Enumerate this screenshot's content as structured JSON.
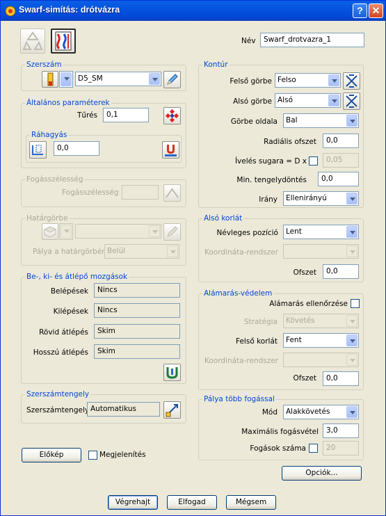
{
  "window": {
    "title": "Swarf-simítás: drótvázra",
    "help_glyph": "?",
    "close_glyph": "✕"
  },
  "top": {
    "name_label": "Név",
    "name_value": "Swarf_drotvazra_1"
  },
  "szerszam": {
    "title": "Szerszám",
    "tool_value": "D5_SM"
  },
  "altalanos": {
    "title": "Általános paraméterek",
    "tures_label": "Tűrés",
    "tures_value": "0,1"
  },
  "rahagyas": {
    "title": "Ráhagyás",
    "value": "0,0"
  },
  "fogasszelesseg": {
    "title": "Fogásszélesség",
    "label": "Fogásszélesség",
    "value": ""
  },
  "hatargorbe": {
    "title": "Határgörbe",
    "curve_value": "",
    "palya_label": "Pálya a határgörbén",
    "palya_value": "Belül"
  },
  "moves": {
    "title": "Be-, ki- és átlépő mozgások",
    "rows": [
      {
        "label": "Belépések",
        "value": "Nincs"
      },
      {
        "label": "Kilépések",
        "value": "Nincs"
      },
      {
        "label": "Rövid átlépés",
        "value": "Skim"
      },
      {
        "label": "Hosszú átlépés",
        "value": "Skim"
      }
    ]
  },
  "tengely": {
    "title": "Szerszámtengely",
    "label": "Szerszámtengely",
    "value": "Automatikus"
  },
  "bottom_left": {
    "preview_btn": "Előkép",
    "display_label": "Megjelenítés"
  },
  "kontur": {
    "title": "Kontúr",
    "felso_label": "Felső görbe",
    "felso_value": "Felso",
    "also_label": "Alsó görbe",
    "also_value": "Alsó",
    "oldal_label": "Görbe oldala",
    "oldal_value": "Bal",
    "radial_label": "Radiális ofszet",
    "radial_value": "0,0",
    "iveles_label": "Ívelés sugara = D x",
    "iveles_value": "0,05",
    "min_label": "Min. tengelydöntés",
    "min_value": "0,0",
    "irany_label": "Irány",
    "irany_value": "Ellenirányú"
  },
  "also_korlat": {
    "title": "Alsó korlát",
    "pos_label": "Névleges pozíció",
    "pos_value": "Lent",
    "coord_label": "Koordináta-rendszer",
    "coord_value": "",
    "ofszet_label": "Ofszet",
    "ofszet_value": "0,0"
  },
  "alamaras": {
    "title": "Alámarás-védelem",
    "check_label": "Alámarás ellenőrzése",
    "strategia_label": "Stratégia",
    "strategia_value": "Követés",
    "felso_label": "Felső korlát",
    "felso_value": "Fent",
    "coord_label": "Koordináta-rendszer",
    "coord_value": "",
    "ofszet_label": "Ofszet",
    "ofszet_value": "0,0"
  },
  "tobb": {
    "title": "Pálya több fogással",
    "mod_label": "Mód",
    "mod_value": "Alakkövetés",
    "max_label": "Maximális fogásvétel",
    "max_value": "3,0",
    "szam_label": "Fogások száma",
    "szam_value": "20"
  },
  "buttons": {
    "options": "Opciók...",
    "execute": "Végrehajt",
    "accept": "Elfogad",
    "cancel": "Mégsem"
  }
}
